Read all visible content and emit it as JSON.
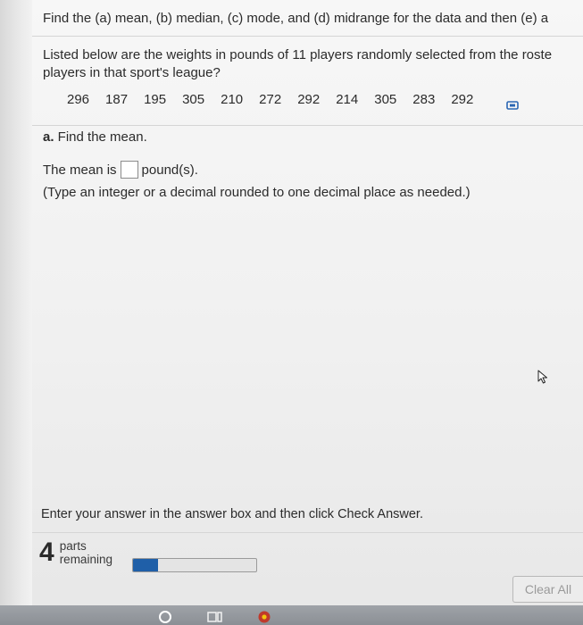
{
  "question": {
    "text": "Find the (a) mean, (b) median, (c) mode, and (d) midrange for the data and then (e) a"
  },
  "prompt": {
    "line1": "Listed below are the weights in pounds of 11 players randomly selected from the roste",
    "line2": "players in that sport's league?"
  },
  "data_values": [
    "296",
    "187",
    "195",
    "305",
    "210",
    "272",
    "292",
    "214",
    "305",
    "283",
    "292"
  ],
  "part_a": {
    "letter": "a.",
    "text": " Find the mean."
  },
  "answer": {
    "prefix": "The mean is",
    "suffix": "pound(s).",
    "hint": "(Type an integer or a decimal rounded to one decimal place as needed.)"
  },
  "footer": {
    "instruction": "Enter your answer in the answer box and then click Check Answer.",
    "parts_count": "4",
    "parts_label_1": "parts",
    "parts_label_2": "remaining",
    "progress_fraction": 0.2,
    "clear_all_label": "Clear All"
  },
  "icons": {
    "copy": "copy-data-icon",
    "cursor": "mouse-pointer-icon"
  },
  "colors": {
    "progress_fill": "#1f5fa8"
  }
}
